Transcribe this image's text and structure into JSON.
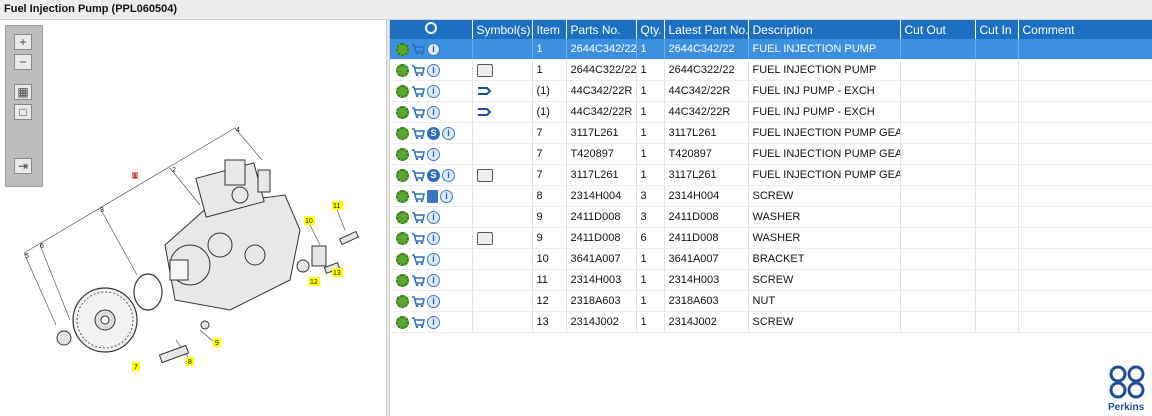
{
  "window": {
    "title": "Fuel Injection Pump (PPL060504)"
  },
  "toolbar": {
    "zoom_in": "zoom-in",
    "zoom_out": "zoom-out",
    "fit": "fit",
    "actual": "actual",
    "export": "export"
  },
  "diagram": {
    "callouts": [
      "1",
      "2",
      "3",
      "4",
      "5",
      "6",
      "7",
      "8",
      "9",
      "10",
      "11",
      "12",
      "13"
    ]
  },
  "grid": {
    "columns": [
      "",
      "Symbol(s)",
      "Item",
      "Parts No.",
      "Qty.",
      "Latest Part No.",
      "Description",
      "Cut Out",
      "Cut In",
      "Comment"
    ],
    "rows": [
      {
        "icons": [
          "gear",
          "cart",
          "info"
        ],
        "symbol": "",
        "item": "1",
        "part": "2644C342/22",
        "qty": "1",
        "latest": "2644C342/22",
        "desc": "FUEL INJECTION PUMP",
        "selected": true
      },
      {
        "icons": [
          "gear",
          "cart",
          "info"
        ],
        "symbol": "book",
        "item": "1",
        "part": "2644C322/22",
        "qty": "1",
        "latest": "2644C322/22",
        "desc": "FUEL INJECTION PUMP"
      },
      {
        "icons": [
          "gear",
          "cart",
          "info"
        ],
        "symbol": "exch",
        "item": "(1)",
        "part": "44C342/22R",
        "qty": "1",
        "latest": "44C342/22R",
        "desc": "FUEL INJ PUMP - EXCH"
      },
      {
        "icons": [
          "gear",
          "cart",
          "info"
        ],
        "symbol": "exch",
        "item": "(1)",
        "part": "44C342/22R",
        "qty": "1",
        "latest": "44C342/22R",
        "desc": "FUEL INJ PUMP - EXCH"
      },
      {
        "icons": [
          "gear",
          "cart",
          "s",
          "info"
        ],
        "symbol": "",
        "item": "7",
        "part": "3117L261",
        "qty": "1",
        "latest": "3117L261",
        "desc": "FUEL INJECTION PUMP GEAR"
      },
      {
        "icons": [
          "gear",
          "cart",
          "info"
        ],
        "symbol": "",
        "item": "7",
        "part": "T420897",
        "qty": "1",
        "latest": "T420897",
        "desc": "FUEL INJECTION PUMP GEAR"
      },
      {
        "icons": [
          "gear",
          "cart",
          "s",
          "info"
        ],
        "symbol": "book",
        "item": "7",
        "part": "3117L261",
        "qty": "1",
        "latest": "3117L261",
        "desc": "FUEL INJECTION PUMP GEAR"
      },
      {
        "icons": [
          "gear",
          "cart",
          "doc",
          "info"
        ],
        "symbol": "",
        "item": "8",
        "part": "2314H004",
        "qty": "3",
        "latest": "2314H004",
        "desc": "SCREW"
      },
      {
        "icons": [
          "gear",
          "cart",
          "info"
        ],
        "symbol": "",
        "item": "9",
        "part": "2411D008",
        "qty": "3",
        "latest": "2411D008",
        "desc": "WASHER"
      },
      {
        "icons": [
          "gear",
          "cart",
          "info"
        ],
        "symbol": "book",
        "item": "9",
        "part": "2411D008",
        "qty": "6",
        "latest": "2411D008",
        "desc": "WASHER"
      },
      {
        "icons": [
          "gear",
          "cart",
          "info"
        ],
        "symbol": "",
        "item": "10",
        "part": "3641A007",
        "qty": "1",
        "latest": "3641A007",
        "desc": "BRACKET"
      },
      {
        "icons": [
          "gear",
          "cart",
          "info"
        ],
        "symbol": "",
        "item": "11",
        "part": "2314H003",
        "qty": "1",
        "latest": "2314H003",
        "desc": "SCREW"
      },
      {
        "icons": [
          "gear",
          "cart",
          "info"
        ],
        "symbol": "",
        "item": "12",
        "part": "2318A603",
        "qty": "1",
        "latest": "2318A603",
        "desc": "NUT"
      },
      {
        "icons": [
          "gear",
          "cart",
          "info"
        ],
        "symbol": "",
        "item": "13",
        "part": "2314J002",
        "qty": "1",
        "latest": "2314J002",
        "desc": "SCREW"
      }
    ]
  },
  "brand": {
    "name": "Perkins"
  },
  "colors": {
    "header": "#1d6fc2",
    "selected": "#3d8fe0",
    "callout": "#ffff00"
  }
}
